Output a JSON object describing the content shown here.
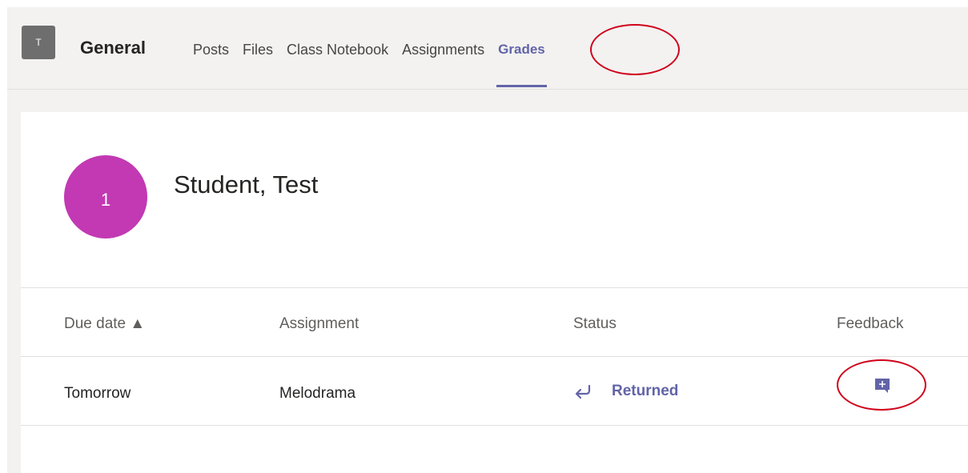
{
  "header": {
    "team_avatar_letter": "T",
    "channel_name": "General",
    "tabs": [
      {
        "label": "Posts",
        "active": false
      },
      {
        "label": "Files",
        "active": false
      },
      {
        "label": "Class Notebook",
        "active": false
      },
      {
        "label": "Assignments",
        "active": false
      },
      {
        "label": "Grades",
        "active": true
      }
    ]
  },
  "student": {
    "avatar_text": "1",
    "name": "Student, Test"
  },
  "table": {
    "columns": {
      "due_date": "Due date ▲",
      "assignment": "Assignment",
      "status": "Status",
      "feedback": "Feedback"
    },
    "rows": [
      {
        "due_date": "Tomorrow",
        "assignment": "Melodrama",
        "status": "Returned",
        "status_icon": "return-arrow-icon",
        "feedback_icon": "add-feedback-icon"
      }
    ]
  },
  "colors": {
    "accent": "#6264a7",
    "avatar": "#c239b3",
    "annotation": "#d0021b"
  }
}
